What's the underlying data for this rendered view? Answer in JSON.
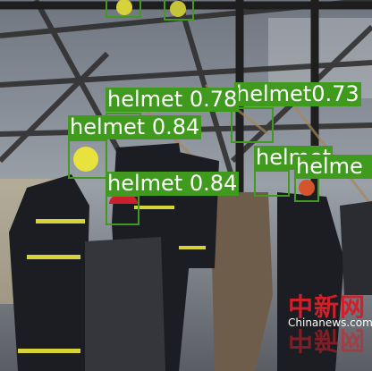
{
  "box_color": "#3f9a1e",
  "detections": [
    {
      "label": "helmet",
      "score": "0.78"
    },
    {
      "label": "helmet",
      "score": "0.73"
    },
    {
      "label": "helmet",
      "score": "0.84"
    },
    {
      "label": "helmet",
      "score": "0.84"
    },
    {
      "label": "helmet",
      "score": ""
    },
    {
      "label": "helme",
      "score": ""
    },
    {
      "label": "",
      "score": ""
    },
    {
      "label": "",
      "score": ""
    }
  ],
  "watermark": {
    "logo": "中新网",
    "site": "Chinanews.com"
  }
}
